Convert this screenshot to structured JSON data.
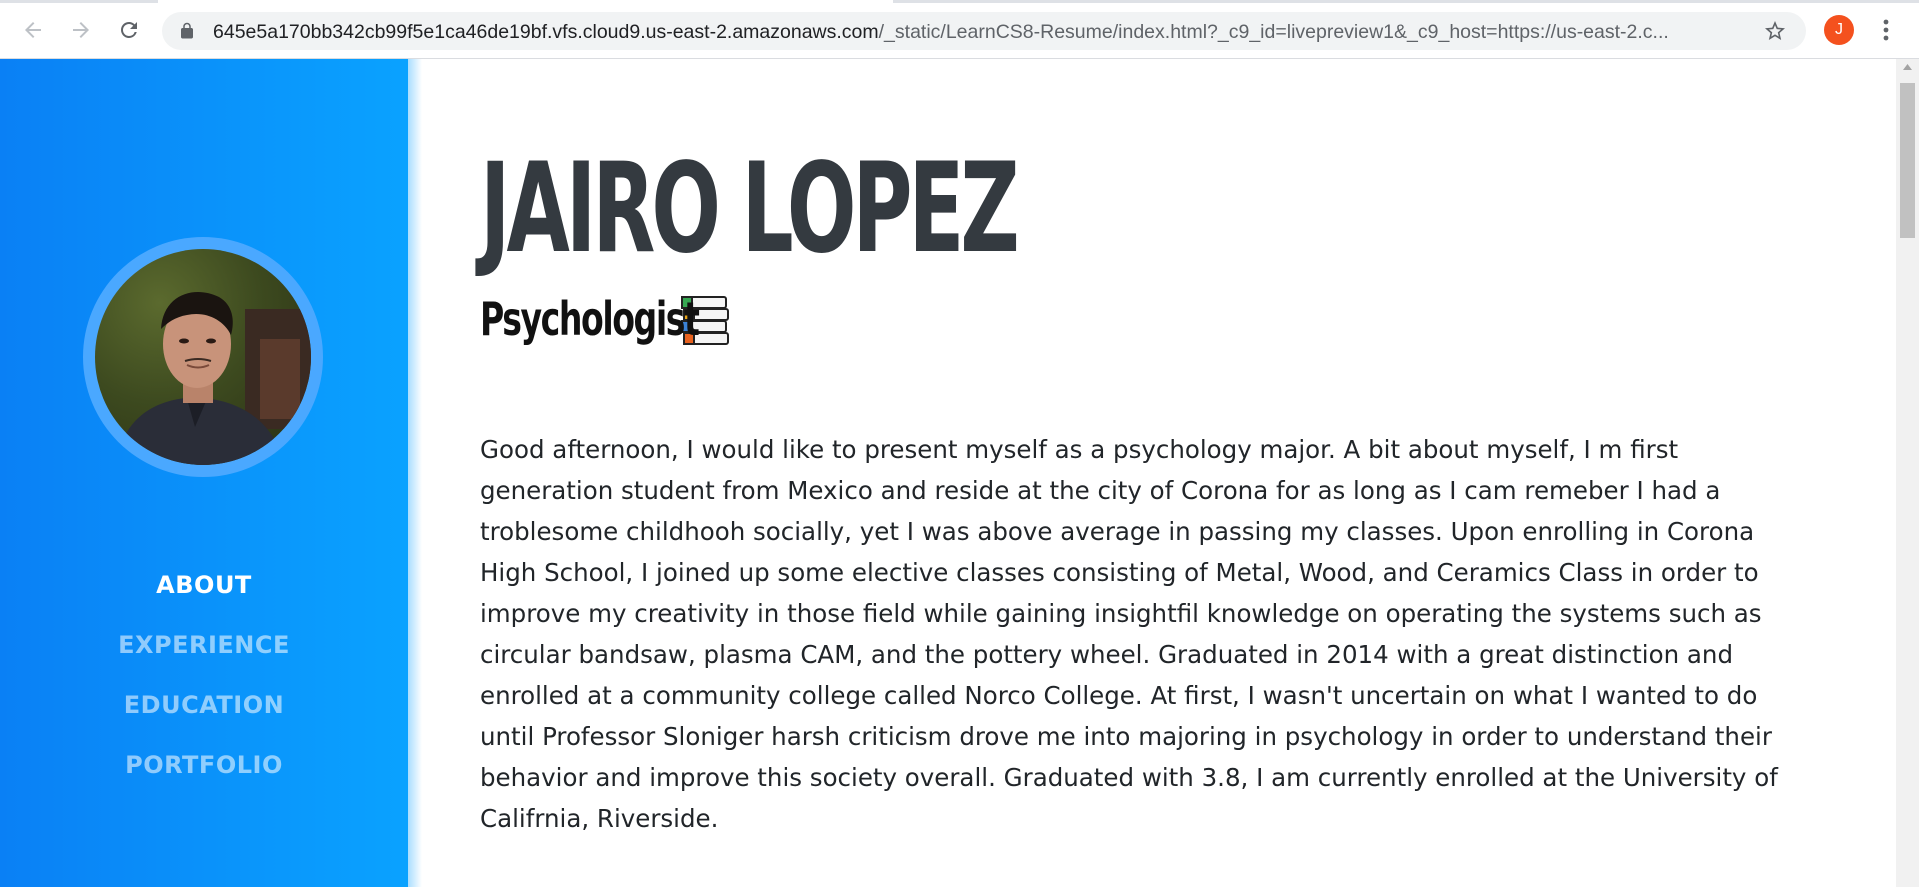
{
  "browser": {
    "url_host": "645e5a170bb342cb99f5e1ca46de19bf.vfs.cloud9.us-east-2.amazonaws.com",
    "url_path": "/_static/LearnCS8-Resume/index.html?_c9_id=livepreview1&_c9_host=https://us-east-2.c...",
    "profile_initial": "J",
    "icons": {
      "back": "arrow-left-icon",
      "forward": "arrow-right-icon",
      "reload": "reload-icon",
      "lock": "lock-icon",
      "bookmark": "star-icon",
      "menu": "more-vertical-icon"
    },
    "profile_color": "#f4511e"
  },
  "sidebar": {
    "bg_color": "#0a8ef9",
    "ring_color": "#4aa8ff",
    "nav": [
      {
        "label": "ABOUT",
        "active": true
      },
      {
        "label": "EXPERIENCE",
        "active": false
      },
      {
        "label": "EDUCATION",
        "active": false
      },
      {
        "label": "PORTFOLIO",
        "active": false
      }
    ]
  },
  "main": {
    "name": "JAIRO LOPEZ",
    "subtitle": "Psychologist",
    "subtitle_icon": "books-icon",
    "bio": "Good afternoon, I would like to present myself as a psychology major. A bit about myself, I m first generation student from Mexico and reside at the city of Corona for as long as I cam remeber I had a troblesome childhooh socially, yet I was above average in passing my classes. Upon enrolling in Corona High School, I joined up some elective classes consisting of Metal, Wood, and Ceramics Class in order to improve my creativity in those field while gaining insightfil knowledge on operating the systems such as circular bandsaw, plasma CAM, and the pottery wheel. Graduated in 2014 with a great distinction and enrolled at a community college called Norco College. At first, I wasn't uncertain on what I wanted to do until Professor Sloniger harsh criticism drove me into majoring in psychology in order to understand their behavior and improve this society overall. Graduated with 3.8, I am currently enrolled at the University of Califrnia, Riverside.",
    "name_color": "#343a40"
  }
}
